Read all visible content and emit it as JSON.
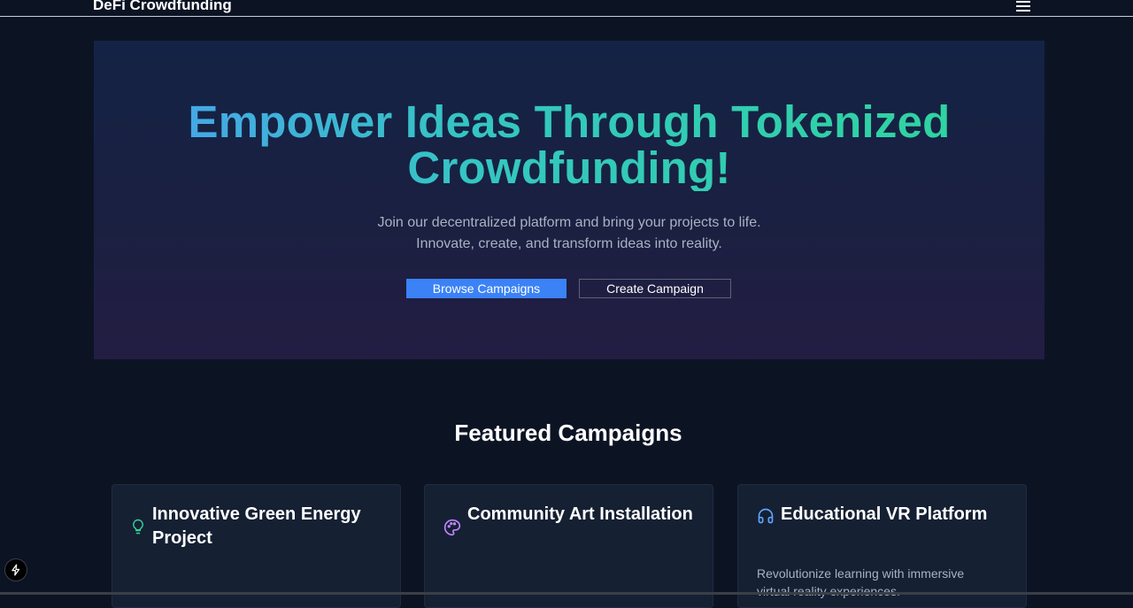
{
  "header": {
    "brand": "DeFi Crowdfunding",
    "menu_icon": "hamburger-menu-icon"
  },
  "hero": {
    "title": "Empower Ideas Through Tokenized Crowdfunding!",
    "subtitle_line1": "Join our decentralized platform and bring your projects to life.",
    "subtitle_line2": "Innovate, create, and transform ideas into reality.",
    "primary_button": "Browse Campaigns",
    "secondary_button": "Create Campaign",
    "gradient_colors": [
      "#4a9ef0",
      "#34c6c2",
      "#2ed69a"
    ]
  },
  "featured": {
    "title": "Featured Campaigns",
    "campaigns": [
      {
        "title": "Innovative Green Energy Project",
        "icon": "lightbulb-icon",
        "icon_color": "#34d399",
        "description": ""
      },
      {
        "title": "Community Art Installation",
        "icon": "palette-icon",
        "icon_color": "#c084fc",
        "description": ""
      },
      {
        "title": "Educational VR Platform",
        "icon": "headphones-icon",
        "icon_color": "#60a5fa",
        "description": "Revolutionize learning with immersive virtual reality experiences."
      }
    ]
  },
  "colors": {
    "background": "#0c1424",
    "card": "#152033",
    "accent": "#3b82f6"
  }
}
